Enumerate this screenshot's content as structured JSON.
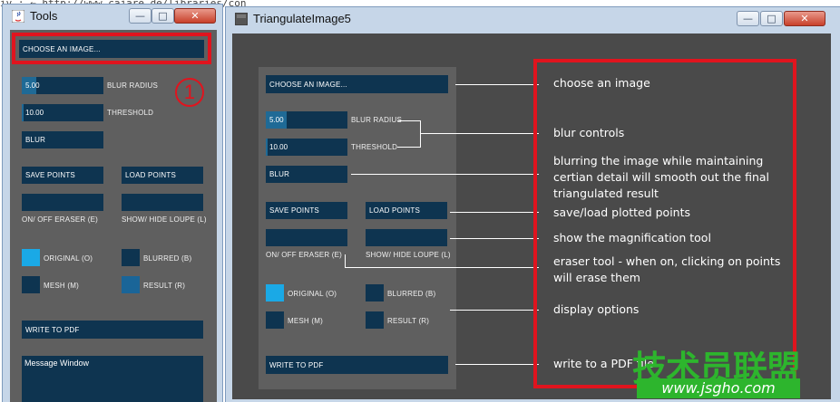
{
  "background": {
    "browser_text": "iv : ← http://www.cajare.de/libraries/con"
  },
  "tools_window": {
    "title": "Tools",
    "controls": {
      "minimize": "—",
      "maximize": "□",
      "close": "✕"
    },
    "choose_image": "CHOOSE AN IMAGE...",
    "blur_radius": {
      "value": "5.00",
      "label": "BLUR RADIUS",
      "fill_fraction": 0.18
    },
    "threshold": {
      "value": "10.00",
      "label": "THRESHOLD",
      "fill_fraction": 0.02
    },
    "blur_button": "BLUR",
    "save_points": "SAVE POINTS",
    "load_points": "LOAD POINTS",
    "eraser_label": "ON/ OFF ERASER (E)",
    "loupe_label": "SHOW/ HIDE LOUPE (L)",
    "display": {
      "original": "ORIGINAL (O)",
      "blurred": "BLURRED (B)",
      "mesh": "MESH (M)",
      "result": "RESULT (R)"
    },
    "write_pdf": "WRITE TO PDF",
    "message_window": "Message Window",
    "step_number": "1"
  },
  "main_window": {
    "title": "TriangulateImage5",
    "controls": {
      "minimize": "—",
      "maximize": "□",
      "close": "✕"
    },
    "choose_image": "CHOOSE AN IMAGE...",
    "blur_radius": {
      "value": "5.00",
      "label": "BLUR RADIUS",
      "fill_fraction": 0.25
    },
    "threshold": {
      "value": "10.00",
      "label": "THRESHOLD",
      "fill_fraction": 0.02
    },
    "blur_button": "BLUR",
    "save_points": "SAVE POINTS",
    "load_points": "LOAD POINTS",
    "eraser_label": "ON/ OFF ERASER (E)",
    "loupe_label": "SHOW/ HIDE LOUPE (L)",
    "display": {
      "original": "ORIGINAL (O)",
      "blurred": "BLURRED (B)",
      "mesh": "MESH (M)",
      "result": "RESULT (R)"
    },
    "write_pdf": "WRITE TO PDF"
  },
  "annotations": {
    "choose": "choose an image",
    "blur_controls": "blur controls",
    "blur_desc": "blurring the image while maintaining certian detail will smooth out the final triangulated result",
    "save_load": "save/load plotted points",
    "magnification": "show the magnification tool",
    "eraser": "eraser tool - when on, clicking on points will erase them",
    "display": "display options",
    "pdf": "write to a PDF file"
  },
  "watermark": {
    "cn_text": "技术员联盟",
    "url": "www.jsgho.com"
  },
  "colors": {
    "highlight_red": "#e0141e",
    "control_navy": "#0e3450",
    "toggle_on": "#1aa9e6",
    "panel_gray": "#5f5f5f",
    "client_dark": "#4a4a4a",
    "watermark_green": "#2db52d"
  }
}
